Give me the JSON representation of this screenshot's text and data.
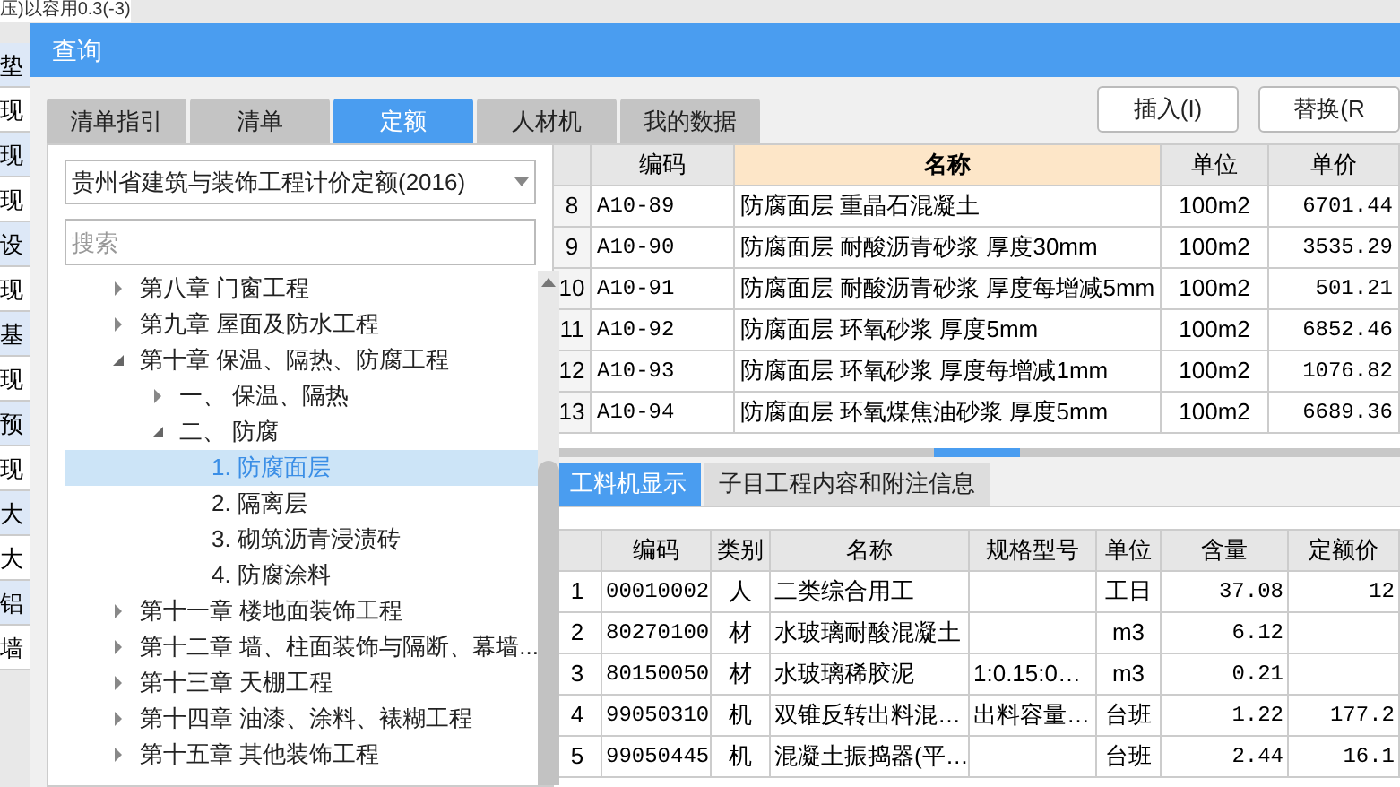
{
  "background": {
    "top_text": "压)以容用0.3(-3)",
    "cells": [
      "垫",
      "现",
      "现",
      "现",
      "设",
      "现",
      "基",
      "现",
      "预",
      "现",
      "大",
      "大",
      "铝",
      "墙"
    ]
  },
  "window": {
    "title": "查询"
  },
  "tabs": [
    {
      "label": "清单指引",
      "selected": false
    },
    {
      "label": "清单",
      "selected": false
    },
    {
      "label": "定额",
      "selected": true
    },
    {
      "label": "人材机",
      "selected": false
    },
    {
      "label": "我的数据",
      "selected": false
    }
  ],
  "buttons": [
    "插入(I)",
    "替换(R"
  ],
  "library_select": {
    "value": "贵州省建筑与装饰工程计价定额(2016)"
  },
  "search": {
    "placeholder": "搜索"
  },
  "tree": [
    {
      "label": "第八章 门窗工程",
      "expanded": false,
      "selected": false
    },
    {
      "label": "第九章 屋面及防水工程",
      "expanded": false,
      "selected": false
    },
    {
      "label": "第十章 保温、隔热、防腐工程",
      "expanded": true,
      "selected": false,
      "children": [
        {
          "label": "一、 保温、隔热",
          "expanded": false,
          "selected": false
        },
        {
          "label": "二、 防腐",
          "expanded": true,
          "selected": false,
          "children": [
            {
              "label": "1. 防腐面层",
              "selected": true
            },
            {
              "label": "2. 隔离层",
              "selected": false
            },
            {
              "label": "3. 砌筑沥青浸渍砖",
              "selected": false
            },
            {
              "label": "4. 防腐涂料",
              "selected": false
            }
          ]
        }
      ]
    },
    {
      "label": "第十一章 楼地面装饰工程",
      "expanded": false,
      "selected": false
    },
    {
      "label": "第十二章 墙、柱面装饰与隔断、幕墙...",
      "expanded": false,
      "selected": false
    },
    {
      "label": "第十三章 天棚工程",
      "expanded": false,
      "selected": false
    },
    {
      "label": "第十四章 油漆、涂料、裱糊工程",
      "expanded": false,
      "selected": false
    },
    {
      "label": "第十五章 其他装饰工程",
      "expanded": false,
      "selected": false
    }
  ],
  "quota_table": {
    "columns": [
      {
        "sorted": false
      },
      {
        "label": "编码",
        "sorted": false
      },
      {
        "label": "名称",
        "sorted": true
      },
      {
        "label": "单位",
        "sorted": false
      },
      {
        "label": "单价",
        "sorted": false
      }
    ],
    "rows": [
      [
        "8",
        "A10-89",
        "防腐面层 重晶石混凝土",
        "100m2",
        "6701.44"
      ],
      [
        "9",
        "A10-90",
        "防腐面层 耐酸沥青砂浆 厚度30mm",
        "100m2",
        "3535.29"
      ],
      [
        "10",
        "A10-91",
        "防腐面层 耐酸沥青砂浆 厚度每增减5mm",
        "100m2",
        "501.21"
      ],
      [
        "11",
        "A10-92",
        "防腐面层 环氧砂浆 厚度5mm",
        "100m2",
        "6852.46"
      ],
      [
        "12",
        "A10-93",
        "防腐面层 环氧砂浆 厚度每增减1mm",
        "100m2",
        "1076.82"
      ],
      [
        "13",
        "A10-94",
        "防腐面层 环氧煤焦油砂浆 厚度5mm",
        "100m2",
        "6689.36"
      ]
    ]
  },
  "detail_tabs": [
    {
      "label": "工料机显示",
      "selected": true
    },
    {
      "label": "子目工程内容和附注信息",
      "selected": false
    }
  ],
  "resource_table": {
    "columns": [
      "",
      "编码",
      "类别",
      "名称",
      "规格型号",
      "单位",
      "含量",
      "定额价"
    ],
    "rows": [
      [
        "1",
        "00010002",
        "人",
        "二类综合用工",
        "",
        "工日",
        "37.08",
        "12"
      ],
      [
        "2",
        "80270100",
        "材",
        "水玻璃耐酸混凝土",
        "",
        "m3",
        "6.12",
        ""
      ],
      [
        "3",
        "80150050",
        "材",
        "水玻璃稀胶泥",
        "1:0.15:0…",
        "m3",
        "0.21",
        ""
      ],
      [
        "4",
        "99050310",
        "机",
        "双锥反转出料混…",
        "出料容量…",
        "台班",
        "1.22",
        "177.2"
      ],
      [
        "5",
        "99050445",
        "机",
        "混凝土振捣器(平…",
        "",
        "台班",
        "2.44",
        "16.1"
      ]
    ]
  }
}
